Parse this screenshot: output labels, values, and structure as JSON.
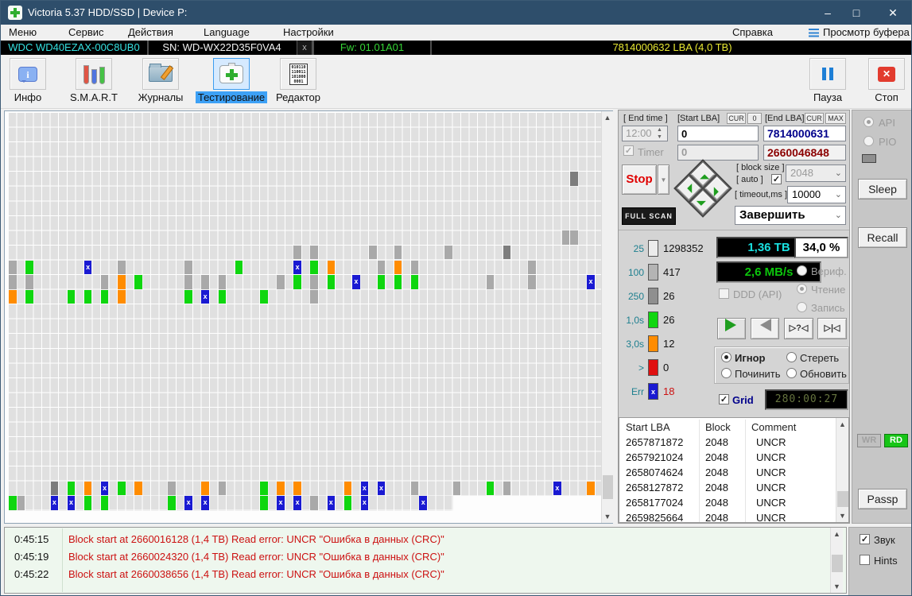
{
  "window": {
    "title": "Victoria 5.37 HDD/SSD | Device P:",
    "controls": {
      "minimize": "–",
      "maximize": "□",
      "close": "✕"
    }
  },
  "menu": {
    "items": [
      "Меню",
      "Сервис",
      "Действия",
      "Language",
      "Настройки"
    ],
    "help": "Справка",
    "buffer_view": "Просмотр буфера"
  },
  "device_bar": {
    "model": "WDC WD40EZAX-00C8UB0",
    "model_color": "#35e0e0",
    "serial": "SN: WD-WX22D35F0VA4",
    "serial_color": "#f2f2f2",
    "close": "x",
    "firmware": "Fw: 01.01A01",
    "firmware_color": "#35d435",
    "capacity": "7814000632 LBA (4,0 TB)",
    "capacity_color": "#e8e832"
  },
  "toolbar": {
    "buttons": [
      {
        "label": "Инфо",
        "icon": "info-icon",
        "active": false
      },
      {
        "label": "S.M.A.R.T",
        "icon": "smart-icon",
        "active": false
      },
      {
        "label": "Журналы",
        "icon": "logs-icon",
        "active": false
      },
      {
        "label": "Тестирование",
        "icon": "test-icon",
        "active": true
      },
      {
        "label": "Редактор",
        "icon": "editor-icon",
        "active": false
      }
    ],
    "editor_icon_text": "010110 110011 101000 0001",
    "pause": {
      "label": "Пауза",
      "icon": "pause-icon"
    },
    "stop": {
      "label": "Стоп",
      "icon": "stop-icon"
    }
  },
  "controls": {
    "end_time_label": "[ End time ]",
    "end_time_value": "12:00",
    "timer_label": "Timer",
    "start_lba_label": "[Start LBA]",
    "cur_btn": "CUR",
    "zero_btn": "0",
    "start_lba_value": "0",
    "start_lba_value2": "0",
    "end_lba_label": "[End LBA]",
    "max_btn": "MAX",
    "end_lba_value": "7814000631",
    "current_lba_value": "2660046848",
    "stop_button": "Stop",
    "block_size_label": "[ block size ]",
    "auto_label": "[ auto ]",
    "block_size_value": "2048",
    "timeout_label": "[ timeout,ms ]",
    "timeout_value": "10000",
    "full_scan": "FULL SCAN",
    "finish_action": "Завершить"
  },
  "legend": {
    "rows": [
      {
        "label": "25",
        "count": "1298352",
        "color": "#ececec",
        "glyph": ""
      },
      {
        "label": "100",
        "count": "417",
        "color": "#b4b4b4",
        "glyph": ""
      },
      {
        "label": "250",
        "count": "26",
        "color": "#8f8f8f",
        "glyph": ""
      },
      {
        "label": "1,0s",
        "count": "26",
        "color": "#0fd60f",
        "glyph": ""
      },
      {
        "label": "3,0s",
        "count": "12",
        "color": "#ff8c00",
        "glyph": ""
      },
      {
        "label": ">",
        "count": "0",
        "color": "#e01010",
        "glyph": ""
      },
      {
        "label": "Err",
        "count": "18",
        "color": "#1a1ad2",
        "glyph": "x",
        "count_color": "#cc1111"
      }
    ]
  },
  "status": {
    "position": "1,36 TB",
    "percent": "34,0 %",
    "speed": "2,6 MB/s",
    "ddd_label": "DDD (API)",
    "mode_verify": "Вериф.",
    "mode_read": "Чтение",
    "mode_write": "Запись",
    "act_ignore": "Игнор",
    "act_erase": "Стереть",
    "act_remap": "Починить",
    "act_refresh": "Обновить",
    "grid_label": "Grid",
    "timer_display": "280:00:27",
    "seek_test": "▷?◁",
    "seek_home": "▷|◁"
  },
  "defect_table": {
    "headers": [
      "Start LBA",
      "Block",
      "Comment"
    ],
    "rows": [
      [
        "2657871872",
        "2048",
        "UNCR"
      ],
      [
        "2657921024",
        "2048",
        "UNCR"
      ],
      [
        "2658074624",
        "2048",
        "UNCR"
      ],
      [
        "2658127872",
        "2048",
        "UNCR"
      ],
      [
        "2658177024",
        "2048",
        "UNCR"
      ],
      [
        "2659825664",
        "2048",
        "UNCR"
      ]
    ]
  },
  "log": {
    "entries": [
      {
        "time": "0:45:15",
        "message": "Block start at 2660016128 (1,4 TB) Read error: UNCR \"Ошибка в данных (CRC)\""
      },
      {
        "time": "0:45:19",
        "message": "Block start at 2660024320 (1,4 TB) Read error: UNCR \"Ошибка в данных (CRC)\""
      },
      {
        "time": "0:45:22",
        "message": "Block start at 2660038656 (1,4 TB) Read error: UNCR \"Ошибка в данных (CRC)\""
      }
    ]
  },
  "sidebar": {
    "api": "API",
    "pio": "PIO",
    "sleep": "Sleep",
    "recall": "Recall",
    "wr": "WR",
    "rd": "RD",
    "passp": "Passp",
    "sound": "Звук",
    "hints": "Hints"
  },
  "grid_map": {
    "cols": 71,
    "rows": 27,
    "partial_last_row_cols": 53,
    "err_glyph": "x",
    "colors": {
      "g": "#a9a9a9",
      "d": "#7d7d7d",
      "G": "#0fd60f",
      "o": "#ff8c00",
      "x": "#1a1ad2"
    },
    "cells": [
      [
        67,
        4,
        "d"
      ],
      [
        66,
        8,
        "g"
      ],
      [
        67,
        8,
        "g"
      ],
      [
        34,
        9,
        "g"
      ],
      [
        36,
        9,
        "g"
      ],
      [
        43,
        9,
        "g"
      ],
      [
        46,
        9,
        "g"
      ],
      [
        52,
        9,
        "g"
      ],
      [
        59,
        9,
        "d"
      ],
      [
        0,
        10,
        "g"
      ],
      [
        2,
        10,
        "G"
      ],
      [
        9,
        10,
        "x"
      ],
      [
        13,
        10,
        "g"
      ],
      [
        21,
        10,
        "g"
      ],
      [
        27,
        10,
        "G"
      ],
      [
        34,
        10,
        "x"
      ],
      [
        36,
        10,
        "G"
      ],
      [
        38,
        10,
        "o"
      ],
      [
        44,
        10,
        "g"
      ],
      [
        46,
        10,
        "o"
      ],
      [
        48,
        10,
        "g"
      ],
      [
        62,
        10,
        "g"
      ],
      [
        0,
        11,
        "g"
      ],
      [
        2,
        11,
        "g"
      ],
      [
        11,
        11,
        "g"
      ],
      [
        13,
        11,
        "o"
      ],
      [
        15,
        11,
        "G"
      ],
      [
        21,
        11,
        "g"
      ],
      [
        23,
        11,
        "g"
      ],
      [
        25,
        11,
        "g"
      ],
      [
        32,
        11,
        "g"
      ],
      [
        34,
        11,
        "G"
      ],
      [
        36,
        11,
        "g"
      ],
      [
        38,
        11,
        "G"
      ],
      [
        41,
        11,
        "x"
      ],
      [
        44,
        11,
        "G"
      ],
      [
        46,
        11,
        "G"
      ],
      [
        48,
        11,
        "G"
      ],
      [
        57,
        11,
        "g"
      ],
      [
        62,
        11,
        "g"
      ],
      [
        69,
        11,
        "x"
      ],
      [
        0,
        12,
        "o"
      ],
      [
        2,
        12,
        "G"
      ],
      [
        7,
        12,
        "G"
      ],
      [
        9,
        12,
        "G"
      ],
      [
        11,
        12,
        "G"
      ],
      [
        13,
        12,
        "o"
      ],
      [
        21,
        12,
        "G"
      ],
      [
        23,
        12,
        "x"
      ],
      [
        25,
        12,
        "G"
      ],
      [
        30,
        12,
        "G"
      ],
      [
        36,
        12,
        "g"
      ],
      [
        5,
        25,
        "d"
      ],
      [
        7,
        25,
        "G"
      ],
      [
        9,
        25,
        "o"
      ],
      [
        11,
        25,
        "x"
      ],
      [
        13,
        25,
        "G"
      ],
      [
        15,
        25,
        "o"
      ],
      [
        19,
        25,
        "g"
      ],
      [
        23,
        25,
        "o"
      ],
      [
        25,
        25,
        "g"
      ],
      [
        30,
        25,
        "G"
      ],
      [
        32,
        25,
        "o"
      ],
      [
        34,
        25,
        "o"
      ],
      [
        40,
        25,
        "o"
      ],
      [
        42,
        25,
        "x"
      ],
      [
        44,
        25,
        "x"
      ],
      [
        48,
        25,
        "g"
      ],
      [
        53,
        25,
        "g"
      ],
      [
        57,
        25,
        "G"
      ],
      [
        59,
        25,
        "g"
      ],
      [
        65,
        25,
        "x"
      ],
      [
        69,
        25,
        "o"
      ],
      [
        0,
        26,
        "G"
      ],
      [
        1,
        26,
        "g"
      ],
      [
        5,
        26,
        "x"
      ],
      [
        7,
        26,
        "x"
      ],
      [
        9,
        26,
        "G"
      ],
      [
        11,
        26,
        "G"
      ],
      [
        19,
        26,
        "G"
      ],
      [
        21,
        26,
        "x"
      ],
      [
        23,
        26,
        "x"
      ],
      [
        30,
        26,
        "G"
      ],
      [
        32,
        26,
        "x"
      ],
      [
        34,
        26,
        "x"
      ],
      [
        36,
        26,
        "g"
      ],
      [
        38,
        26,
        "x"
      ],
      [
        40,
        26,
        "G"
      ],
      [
        42,
        26,
        "x"
      ],
      [
        49,
        26,
        "x"
      ]
    ]
  }
}
